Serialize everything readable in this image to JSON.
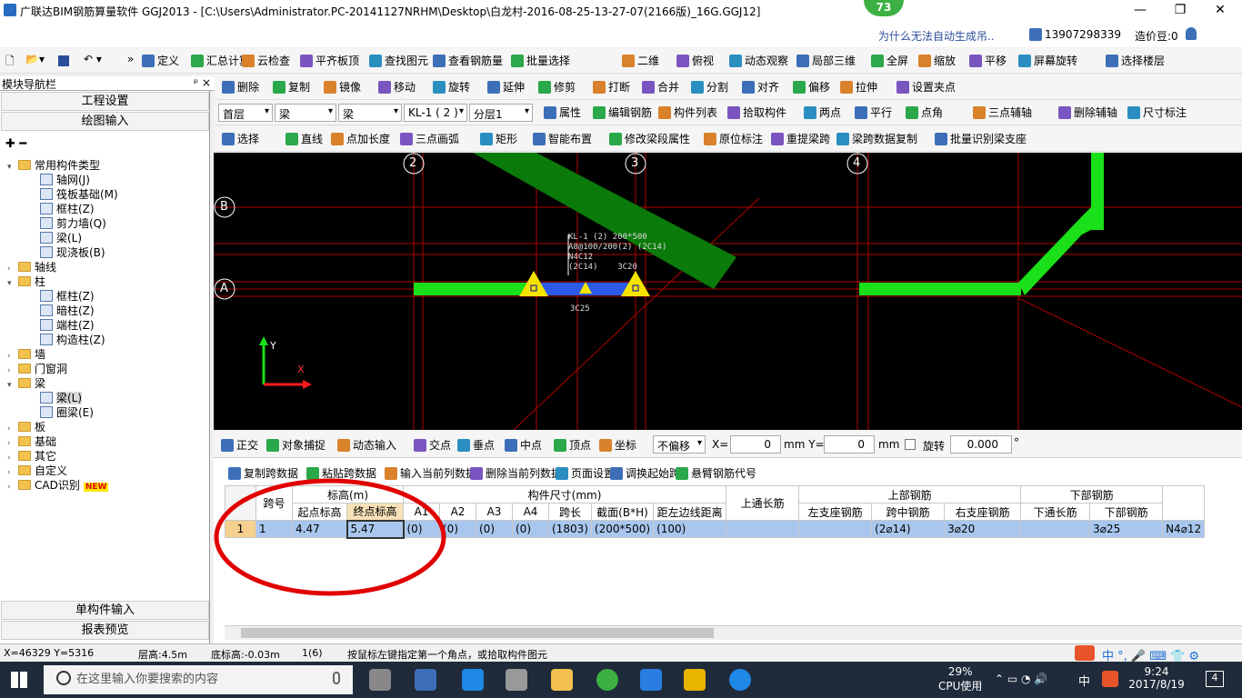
{
  "window": {
    "title": "广联达BIM钢筋算量软件 GGJ2013 - [C:\\Users\\Administrator.PC-20141127NRHM\\Desktop\\白龙村-2016-08-25-13-27-07(2166版)_16G.GGJ12]",
    "badge": "73",
    "minimize": "—",
    "restore": "❐",
    "close": "✕"
  },
  "topinfo": {
    "question": "为什么无法自动生成吊..",
    "phone": "13907298339",
    "beans": "造价豆:0"
  },
  "toolbar1": [
    "定义",
    "汇总计算",
    "云检查",
    "平齐板顶",
    "查找图元",
    "查看钢筋量",
    "批量选择",
    "二维",
    "俯视",
    "动态观察",
    "局部三维",
    "全屏",
    "缩放",
    "平移",
    "屏幕旋转",
    "选择楼层"
  ],
  "toolbar2": [
    "删除",
    "复制",
    "镜像",
    "移动",
    "旋转",
    "延伸",
    "修剪",
    "打断",
    "合并",
    "分割",
    "对齐",
    "偏移",
    "拉伸",
    "设置夹点"
  ],
  "toolbar3": {
    "floor": "首层",
    "type1": "梁",
    "type2": "梁",
    "member": "KL-1 ( 2 )",
    "layer": "分层1",
    "items": [
      "属性",
      "编辑钢筋",
      "构件列表",
      "拾取构件",
      "两点",
      "平行",
      "点角",
      "三点辅轴",
      "删除辅轴",
      "尺寸标注"
    ]
  },
  "toolbar4": [
    "选择",
    "直线",
    "点加长度",
    "三点画弧",
    "矩形",
    "智能布置",
    "修改梁段属性",
    "原位标注",
    "重提梁跨",
    "梁跨数据复制",
    "批量识别梁支座"
  ],
  "nav": {
    "title": "模块导航栏",
    "pin": "ᵖ ×",
    "btn_project": "工程设置",
    "btn_draw": "绘图输入",
    "btn_single": "单构件输入",
    "btn_report": "报表预览",
    "tree": [
      {
        "label": "常用构件类型",
        "level": 0,
        "kind": "folder",
        "exp": "▾"
      },
      {
        "label": "轴网(J)",
        "level": 1,
        "kind": "item"
      },
      {
        "label": "筏板基础(M)",
        "level": 1,
        "kind": "item"
      },
      {
        "label": "框柱(Z)",
        "level": 1,
        "kind": "item"
      },
      {
        "label": "剪力墙(Q)",
        "level": 1,
        "kind": "item"
      },
      {
        "label": "梁(L)",
        "level": 1,
        "kind": "item"
      },
      {
        "label": "现浇板(B)",
        "level": 1,
        "kind": "item"
      },
      {
        "label": "轴线",
        "level": 0,
        "kind": "folder",
        "exp": "›"
      },
      {
        "label": "柱",
        "level": 0,
        "kind": "folder",
        "exp": "▾"
      },
      {
        "label": "框柱(Z)",
        "level": 1,
        "kind": "item"
      },
      {
        "label": "暗柱(Z)",
        "level": 1,
        "kind": "item"
      },
      {
        "label": "端柱(Z)",
        "level": 1,
        "kind": "item"
      },
      {
        "label": "构造柱(Z)",
        "level": 1,
        "kind": "item"
      },
      {
        "label": "墙",
        "level": 0,
        "kind": "folder",
        "exp": "›"
      },
      {
        "label": "门窗洞",
        "level": 0,
        "kind": "folder",
        "exp": "›"
      },
      {
        "label": "梁",
        "level": 0,
        "kind": "folder",
        "exp": "▾"
      },
      {
        "label": "梁(L)",
        "level": 1,
        "kind": "item",
        "selected": true
      },
      {
        "label": "圈梁(E)",
        "level": 1,
        "kind": "item"
      },
      {
        "label": "板",
        "level": 0,
        "kind": "folder",
        "exp": "›"
      },
      {
        "label": "基础",
        "level": 0,
        "kind": "folder",
        "exp": "›"
      },
      {
        "label": "其它",
        "level": 0,
        "kind": "folder",
        "exp": "›"
      },
      {
        "label": "自定义",
        "level": 0,
        "kind": "folder",
        "exp": "›"
      },
      {
        "label": "CAD识别",
        "level": 0,
        "kind": "folder",
        "exp": "›",
        "new": "NEW"
      }
    ]
  },
  "canvas": {
    "axes": [
      "2",
      "3",
      "4",
      "B",
      "A"
    ],
    "beam_label": [
      "KL-1 (2) 200*500",
      "A8@100/200(2) (2C14)",
      "N4C12",
      "(2C14)",
      "3C20",
      "3C25"
    ],
    "coord_x": "X",
    "coord_y": "Y"
  },
  "snapbar": {
    "items": [
      "正交",
      "对象捕捉",
      "动态输入",
      "交点",
      "垂点",
      "中点",
      "顶点",
      "坐标"
    ],
    "offset": "不偏移",
    "x_label": "X=",
    "x_value": "0",
    "y_label": "mm Y=",
    "y_value": "0",
    "unit": "mm",
    "rotate_label": "旋转",
    "rotate_value": "0.000",
    "degree": "°"
  },
  "gridtoolbar": [
    "复制跨数据",
    "粘贴跨数据",
    "输入当前列数据",
    "删除当前列数据",
    "页面设置",
    "调换起始跨",
    "悬臂钢筋代号"
  ],
  "table": {
    "h1": [
      "跨号",
      "标高(m)",
      "构件尺寸(mm)",
      "上通长筋",
      "上部钢筋",
      "下部钢筋"
    ],
    "h2": [
      "起点标高",
      "终点标高",
      "A1",
      "A2",
      "A3",
      "A4",
      "跨长",
      "截面(B*H)",
      "距左边线距离",
      "左支座钢筋",
      "跨中钢筋",
      "右支座钢筋",
      "下通长筋",
      "下部钢筋",
      "侧面通长筋"
    ],
    "row": [
      "1",
      "1",
      "4.47",
      "5.47",
      "(0)",
      "(0)",
      "(0)",
      "(0)",
      "(1803)",
      "(200*500)",
      "(100)",
      "",
      "",
      "(2⌀14)",
      "3⌀20",
      "",
      "3⌀25",
      "N4⌀12"
    ]
  },
  "status": {
    "coords": "X=46329 Y=5316",
    "floor_h": "层高:4.5m",
    "bottom_h": "底标高:-0.03m",
    "count": "1(6)",
    "hint": "按鼠标左键指定第一个角点，或拾取构件图元"
  },
  "taskbar": {
    "search": "在这里输入你要搜索的内容",
    "cpu_pct": "29%",
    "cpu_label": "CPU使用",
    "ime": "中",
    "time": "9:24",
    "date": "2017/8/19",
    "notif": "4"
  }
}
